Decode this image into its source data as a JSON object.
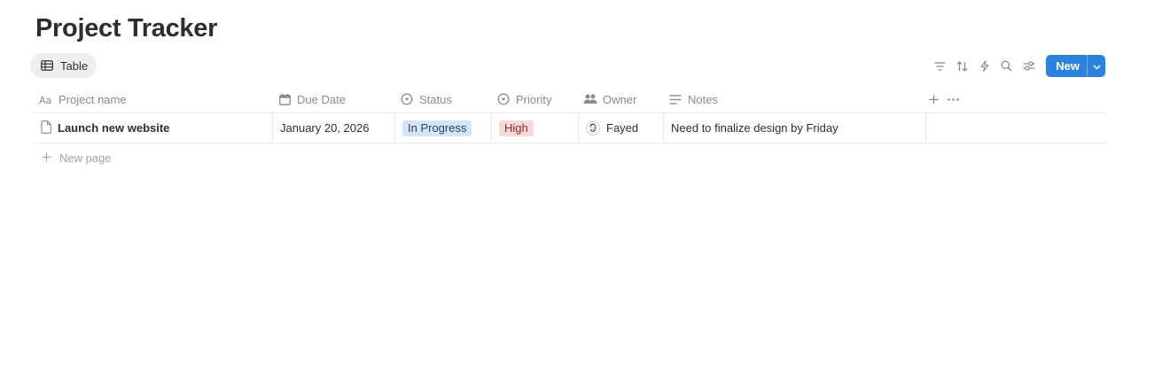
{
  "page": {
    "title": "Project Tracker"
  },
  "view_tab": {
    "label": "Table",
    "icon": "table-icon"
  },
  "toolbar": {
    "icons": [
      "filter-icon",
      "sort-icon",
      "automation-icon",
      "search-icon",
      "settings-icon"
    ],
    "new_label": "New",
    "accent_color": "#2a83dd"
  },
  "table": {
    "columns": [
      {
        "label": "Project name",
        "icon": "text-type-icon"
      },
      {
        "label": "Due Date",
        "icon": "calendar-icon"
      },
      {
        "label": "Status",
        "icon": "status-icon"
      },
      {
        "label": "Priority",
        "icon": "select-icon"
      },
      {
        "label": "Owner",
        "icon": "people-icon"
      },
      {
        "label": "Notes",
        "icon": "text-lines-icon"
      }
    ],
    "rows": [
      {
        "project_name": "Launch new website",
        "due_date": "January 20, 2026",
        "status": "In Progress",
        "priority": "High",
        "owner": "Fayed",
        "notes": "Need to finalize design by Friday"
      }
    ],
    "new_page_label": "New page",
    "status_colors": {
      "bg": "#d3e5f7",
      "text": "#28456c"
    },
    "priority_colors": {
      "bg": "#fbd9d6",
      "text": "#8a2e27"
    }
  }
}
